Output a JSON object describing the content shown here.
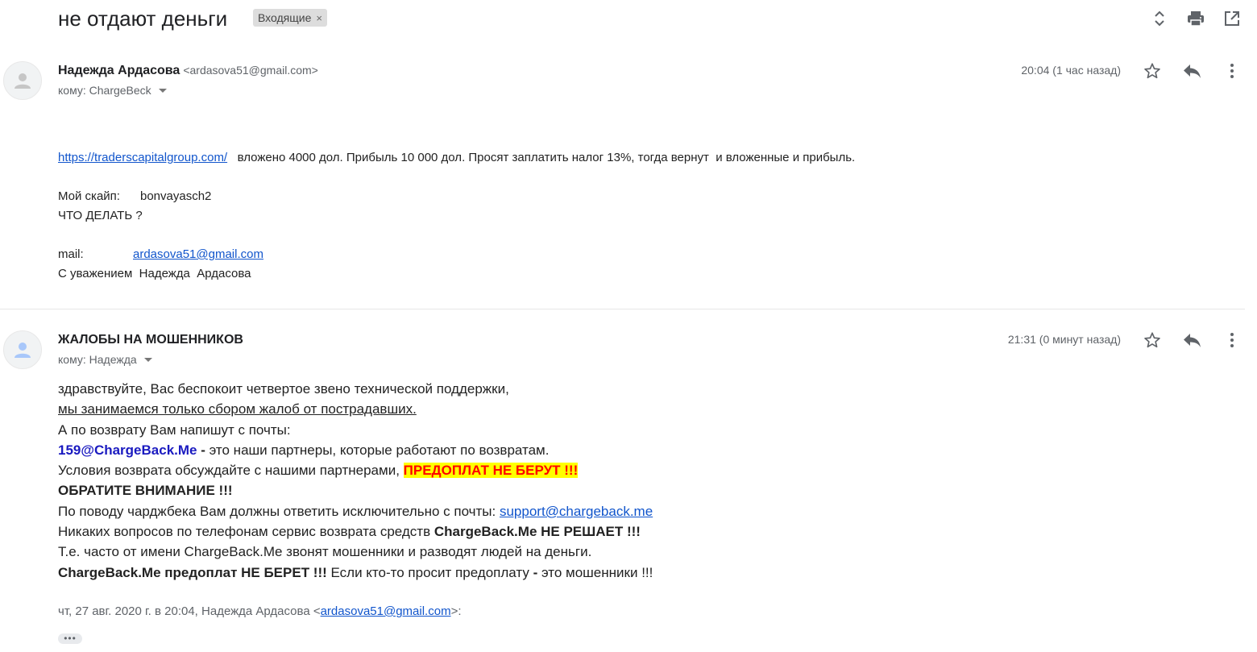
{
  "thread": {
    "subject": "не отдают деньги",
    "label": "Входящие",
    "label_remove": "×"
  },
  "icons": {
    "expand": "unfold-icon",
    "print": "print-icon",
    "popout": "open-in-new-window-icon",
    "star": "star-icon",
    "reply": "reply-icon",
    "more": "more-vert-icon",
    "avatar": "person-icon"
  },
  "message1": {
    "sender_name": "Надежда Ардасова",
    "sender_email": "<ardasova51@gmail.com>",
    "to": "кому: ChargeBeck",
    "time": "20:04 (1 час назад)",
    "link": "https://traderscapitalgroup.com/",
    "text_after_link": "   вложено 4000 дол. Прибыль 10 000 дол. Просят заплатить налог 13%, тогда вернут  и вложенные и прибыль.",
    "line2": "ЧТО ДЕЛАТЬ ?",
    "line3": "С уважением  Надежда  Ардасова",
    "skype_label": "Мой скайп:",
    "skype_value": "bonvayasch2",
    "mail_label": "mail:",
    "mail_value": "ardasova51@gmail.com"
  },
  "message2": {
    "sender_name": "ЖАЛОБЫ НА МОШЕННИКОВ",
    "to": "кому: Надежда",
    "time": "21:31 (0 минут назад)",
    "line1": "здравствуйте, Вас беспокоит четвертое звено технической поддержки,",
    "line2": "мы занимаемся только сбором жалоб от пострадавших.",
    "line3": "А по возврату Вам напишут с почты:",
    "line4_bold": "159@ChargeBack.Me",
    "line4_dash": " - ",
    "line4_rest": "это наши партнеры, которые работают по возвратам.",
    "line5_text": "Условия возврата обсуждайте с нашими партнерами, ",
    "line5_highlight": "ПРЕДОПЛАТ НЕ БЕРУТ !!!",
    "line6": "ОБРАТИТЕ ВНИМАНИЕ !!!",
    "line7_text": "По поводу чарджбека Вам должны ответить исключительно с почты: ",
    "line7_link": "support@chargeback.me",
    "line8_text": "Никаких вопросов по телефонам сервис возврата средств ",
    "line8_bold": "ChargeBack.Me НЕ РЕШАЕТ !!!",
    "line9": "Т.е. часто от имени ChargeBack.Me звонят мошенники и разводят людей на деньги.",
    "line10_bold": "ChargeBack.Me предоплат НЕ БЕРЕТ !!!",
    "line10_text": " Если кто-то просит предоплату ",
    "line10_dash": "-",
    "line10_end": " это мошенники !!!",
    "quote_prefix": "чт, 27 авг. 2020 г. в 20:04, Надежда Ардасова <",
    "quote_email": "ardasova51@gmail.com",
    "quote_suffix": ">:",
    "show_trimmed": "•••"
  }
}
